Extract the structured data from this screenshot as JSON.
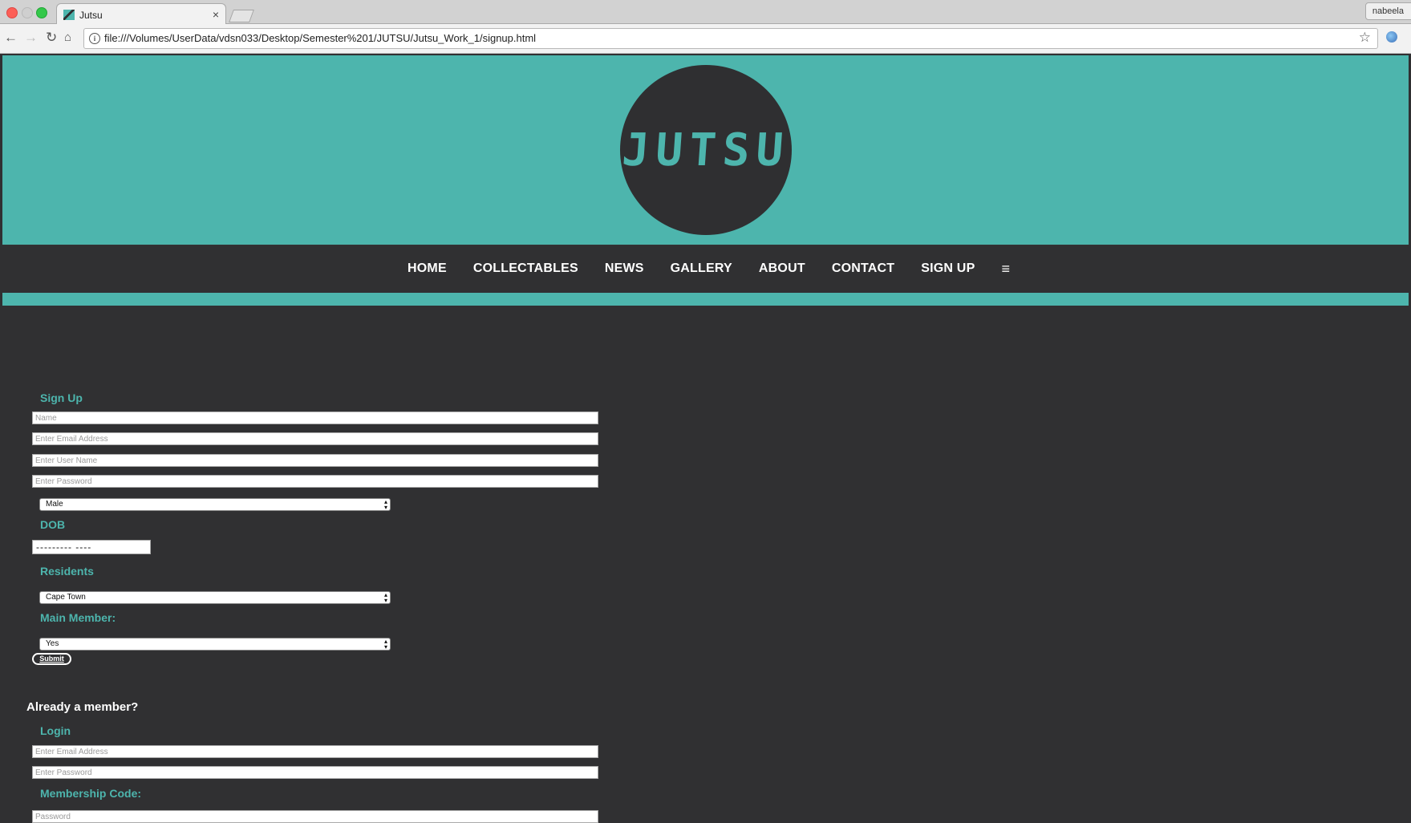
{
  "browser": {
    "tab_title": "Jutsu",
    "tab_close": "×",
    "url": "file:///Volumes/UserData/vdsn033/Desktop/Semester%201/JUTSU/Jutsu_Work_1/signup.html",
    "profile_name": "nabeela",
    "nav": {
      "back": "←",
      "forward": "→",
      "reload": "↻",
      "home": "⌂",
      "info": "i",
      "star": "☆"
    }
  },
  "header": {
    "logo_text": "JUTSU",
    "colors": {
      "teal": "#4db5ad",
      "dark": "#303032"
    }
  },
  "nav": {
    "items": [
      "HOME",
      "COLLECTABLES",
      "NEWS",
      "GALLERY",
      "ABOUT",
      "CONTACT",
      "SIGN UP"
    ],
    "menu_icon": "≡"
  },
  "signup": {
    "title": "Sign Up",
    "name_placeholder": "Name",
    "email_placeholder": "Enter Email Address",
    "username_placeholder": "Enter User Name",
    "password_placeholder": "Enter Password",
    "gender_value": "Male",
    "dob_label": "DOB",
    "dob_value": "---------  ----",
    "residents_label": "Residents",
    "residents_value": "Cape Town",
    "main_member_label": "Main Member:",
    "main_member_value": "Yes",
    "submit_label": "Submit",
    "select_arrows": "▴▾"
  },
  "login": {
    "already_member": "Already a member?",
    "title": "Login",
    "email_placeholder": "Enter Email Address",
    "password_placeholder": "Enter Password",
    "membership_label": "Membership Code:",
    "code_placeholder": "Password"
  }
}
